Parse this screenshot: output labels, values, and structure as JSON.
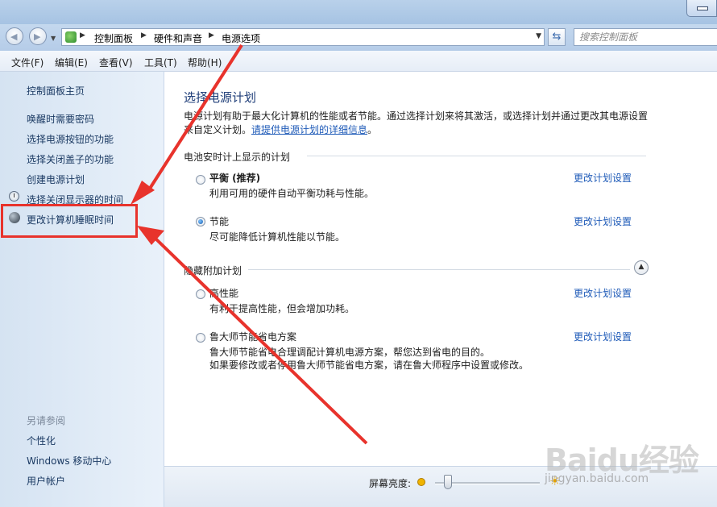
{
  "address_bar": {
    "breadcrumbs": [
      "控制面板",
      "硬件和声音",
      "电源选项"
    ],
    "search_placeholder": "搜索控制面板"
  },
  "menu": [
    "文件(F)",
    "编辑(E)",
    "查看(V)",
    "工具(T)",
    "帮助(H)"
  ],
  "sidebar": {
    "home": "控制面板主页",
    "tasks": [
      "唤醒时需要密码",
      "选择电源按钮的功能",
      "选择关闭盖子的功能",
      "创建电源计划",
      "选择关闭显示器的时间",
      "更改计算机睡眠时间"
    ],
    "see_also_heading": "另请参阅",
    "see_also": [
      "个性化",
      "Windows 移动中心",
      "用户帐户"
    ]
  },
  "main": {
    "title": "选择电源计划",
    "intro_line1": "电源计划有助于最大化计算机的性能或者节能。通过选择计划来将其激活，或选择计划并通过更改其电源设置",
    "intro_line2_prefix": "来自定义计划。",
    "intro_link": "请提供电源计划的详细信息",
    "intro_suffix": "。",
    "group_battery": "电池安时计上显示的计划",
    "group_hidden": "隐藏附加计划",
    "plans": [
      {
        "name": "平衡 (推荐)",
        "desc": "利用可用的硬件自动平衡功耗与性能。",
        "link": "更改计划设置",
        "selected": false
      },
      {
        "name": "节能",
        "desc": "尽可能降低计算机性能以节能。",
        "link": "更改计划设置",
        "selected": true
      },
      {
        "name": "高性能",
        "desc": "有利于提高性能，但会增加功耗。",
        "link": "更改计划设置",
        "selected": false
      },
      {
        "name": "鲁大师节能省电方案",
        "desc": "鲁大师节能省电合理调配计算机电源方案，帮您达到省电的目的。",
        "desc2": "如果要修改或者停用鲁大师节能省电方案，请在鲁大师程序中设置或修改。",
        "link": "更改计划设置",
        "selected": false
      }
    ]
  },
  "brightness": {
    "label": "屏幕亮度:",
    "level_percent": 12
  },
  "watermark": {
    "logo": "Baidu经验",
    "sub": "jingyan.baidu.com"
  },
  "colors": {
    "annotation": "#e8332c",
    "link": "#1f5bb8",
    "title": "#1e3d78"
  }
}
